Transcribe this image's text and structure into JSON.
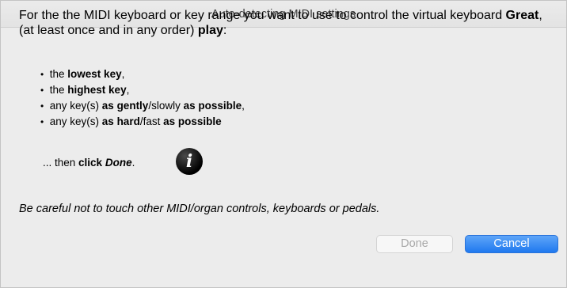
{
  "window": {
    "title": "Auto-detecting MIDI settings"
  },
  "intro": {
    "part1": "For the the MIDI keyboard or key range you want to use to control the virtual keyboard ",
    "keyboard_name": "Great",
    "part2": ", (at least once and in any order) ",
    "play": "play",
    "colon": ":"
  },
  "bullets": [
    {
      "pre": "the ",
      "bold1": "lowest key",
      "mid": ",",
      "bold2": "",
      "post": ""
    },
    {
      "pre": "the ",
      "bold1": "highest key",
      "mid": ",",
      "bold2": "",
      "post": ""
    },
    {
      "pre": "any key(s) ",
      "bold1": "as gently",
      "mid": "/slowly ",
      "bold2": "as possible",
      "post": ","
    },
    {
      "pre": "any key(s) ",
      "bold1": "as hard",
      "mid": "/fast ",
      "bold2": "as possible",
      "post": ""
    }
  ],
  "then_line": {
    "pre": "... then ",
    "click": "click",
    "space": " ",
    "done": "Done",
    "post": "."
  },
  "info_icon": {
    "glyph": "i",
    "icon": "info-icon"
  },
  "warning": "Be careful not to touch other MIDI/organ controls, keyboards or pedals.",
  "buttons": {
    "done": "Done",
    "cancel": "Cancel"
  },
  "colors": {
    "accent": "#1f79ef",
    "disabled_text": "#a8a8a8"
  }
}
